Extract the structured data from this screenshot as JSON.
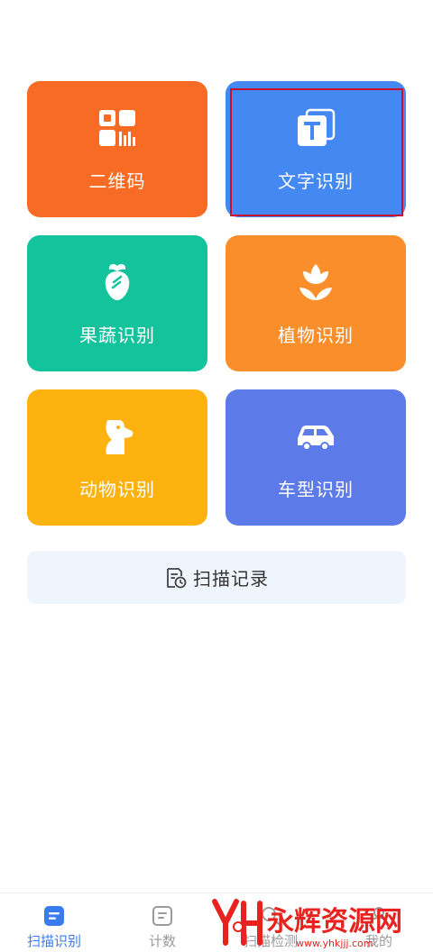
{
  "tiles": [
    {
      "label": "二维码",
      "icon": "qr-code-icon",
      "color": "#f76b25"
    },
    {
      "label": "文字识别",
      "icon": "text-t-icon",
      "color": "#4488f2",
      "selected": true
    },
    {
      "label": "果蔬识别",
      "icon": "carrot-icon",
      "color": "#13c39c"
    },
    {
      "label": "植物识别",
      "icon": "flower-icon",
      "color": "#fa8e2a"
    },
    {
      "label": "动物识别",
      "icon": "dog-icon",
      "color": "#fdb20f"
    },
    {
      "label": "车型识别",
      "icon": "car-icon",
      "color": "#5c7ae8"
    }
  ],
  "records": {
    "label": "扫描记录",
    "icon": "record-document-icon"
  },
  "tabs": [
    {
      "label": "扫描识别",
      "icon": "scan-icon",
      "active": true
    },
    {
      "label": "计数",
      "icon": "count-icon",
      "active": false
    },
    {
      "label": "扫描检测",
      "icon": "detect-icon",
      "active": false
    },
    {
      "label": "我的",
      "icon": "profile-icon",
      "active": false
    }
  ],
  "watermark": {
    "text": "永辉资源网",
    "url": "www.yhkjjj.com"
  }
}
